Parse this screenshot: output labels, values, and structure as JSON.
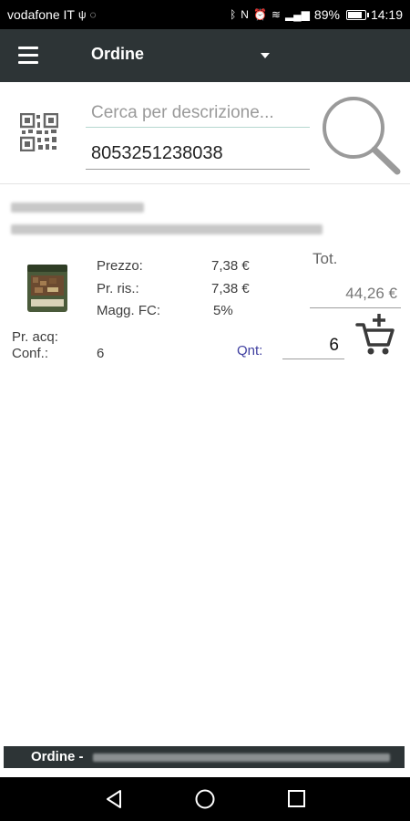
{
  "status_bar": {
    "carrier": "vodafone IT",
    "battery": "89%",
    "battery_fraction": 0.89,
    "time": "14:19"
  },
  "app_bar": {
    "title": "Ordine"
  },
  "search": {
    "placeholder": "Cerca per descrizione...",
    "code_value": "8053251238038"
  },
  "product": {
    "fields": {
      "prezzo_label": "Prezzo:",
      "prezzo_value": "7,38 €",
      "pr_ris_label": "Pr. ris.:",
      "pr_ris_value": "7,38 €",
      "magg_fc_label": "Magg. FC:",
      "magg_fc_value": "5%",
      "pr_acq_label": "Pr. acq:",
      "conf_label": "Conf.:",
      "conf_value": "6"
    },
    "tot_label": "Tot.",
    "tot_value": "44,26 €",
    "qnt_label": "Qnt:",
    "qnt_value": "6"
  },
  "footer": {
    "title": "Ordine -"
  },
  "icons": {
    "menu": "menu-icon",
    "dropdown": "chevron-down-icon",
    "qr": "qr-code-icon",
    "search": "search-icon",
    "cart": "add-to-cart-icon",
    "back": "back-icon",
    "home": "home-icon",
    "recents": "recents-icon"
  },
  "colors": {
    "app_bar": "#2d3436",
    "status_bar": "#000000",
    "qnt_label": "#3f3fa0",
    "search_underline": "#b5d8cf"
  }
}
